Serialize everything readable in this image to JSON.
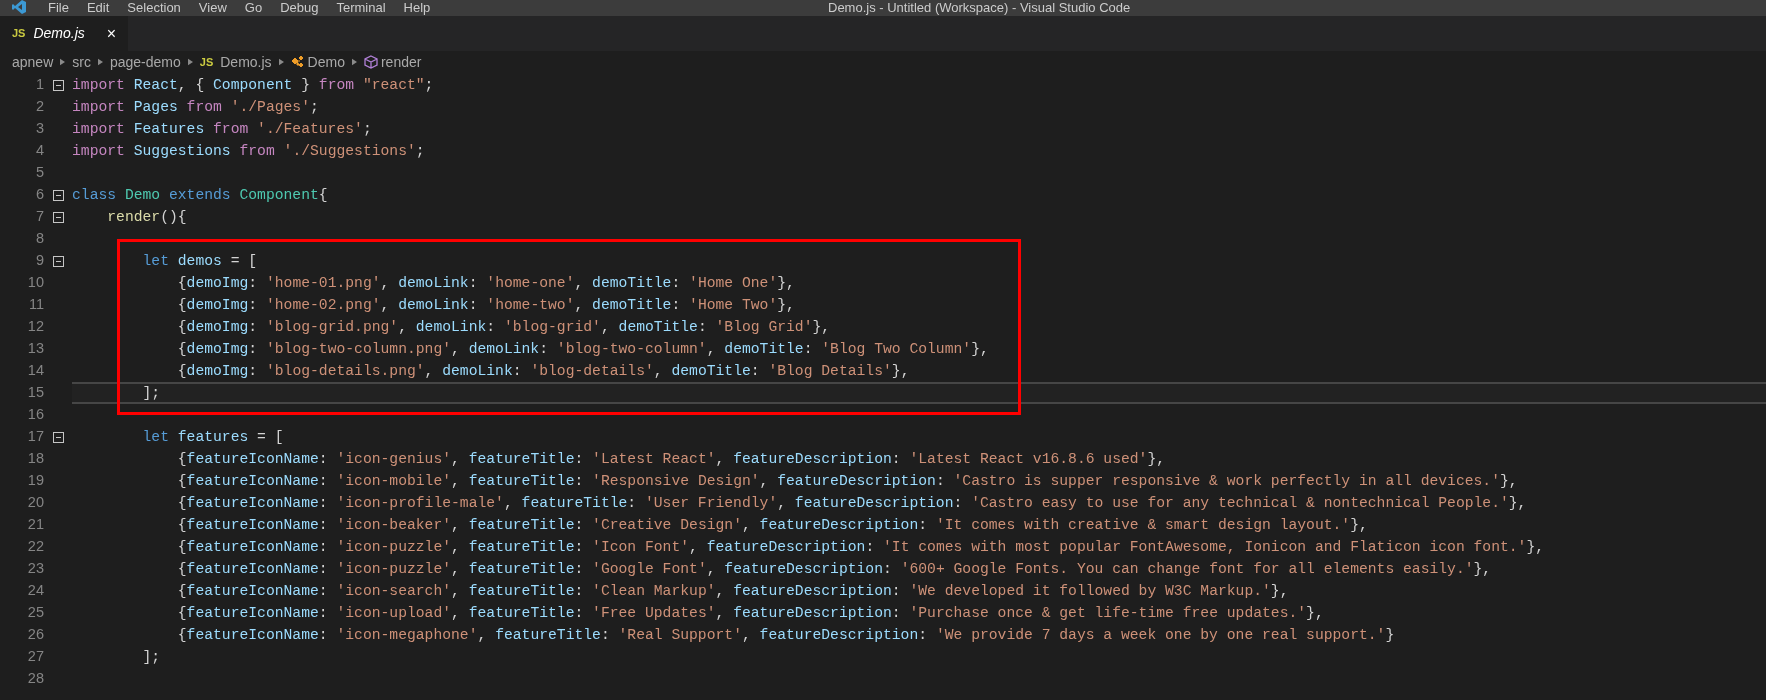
{
  "menu_bar": {
    "items": [
      "File",
      "Edit",
      "Selection",
      "View",
      "Go",
      "Debug",
      "Terminal",
      "Help"
    ],
    "title": "Demo.js - Untitled (Workspace) - Visual Studio Code"
  },
  "tabs": [
    {
      "badge": "JS",
      "label": "Demo.js",
      "close": "×",
      "selected": true
    }
  ],
  "breadcrumb": [
    {
      "kind": "folder",
      "text": "apnew"
    },
    {
      "kind": "folder",
      "text": "src"
    },
    {
      "kind": "folder",
      "text": "page-demo"
    },
    {
      "kind": "file",
      "badge": "JS",
      "text": "Demo.js"
    },
    {
      "kind": "class",
      "text": "Demo"
    },
    {
      "kind": "method",
      "text": "render"
    }
  ],
  "editor": {
    "lines": [
      {
        "number": "1",
        "foldable": true,
        "current": false,
        "tokens": [
          {
            "kind": "keyword",
            "text": "import "
          },
          {
            "kind": "variable",
            "text": "React"
          },
          {
            "kind": "punct",
            "text": ", { "
          },
          {
            "kind": "variable",
            "text": "Component"
          },
          {
            "kind": "punct",
            "text": " } "
          },
          {
            "kind": "keyword",
            "text": "from "
          },
          {
            "kind": "string",
            "text": "\"react\""
          },
          {
            "kind": "punct",
            "text": ";"
          }
        ]
      },
      {
        "number": "2",
        "foldable": false,
        "current": false,
        "tokens": [
          {
            "kind": "keyword",
            "text": "import "
          },
          {
            "kind": "variable",
            "text": "Pages"
          },
          {
            "kind": "keyword",
            "text": " from "
          },
          {
            "kind": "string",
            "text": "'./Pages'"
          },
          {
            "kind": "punct",
            "text": ";"
          }
        ]
      },
      {
        "number": "3",
        "foldable": false,
        "current": false,
        "tokens": [
          {
            "kind": "keyword",
            "text": "import "
          },
          {
            "kind": "variable",
            "text": "Features"
          },
          {
            "kind": "keyword",
            "text": " from "
          },
          {
            "kind": "string",
            "text": "'./Features'"
          },
          {
            "kind": "punct",
            "text": ";"
          }
        ]
      },
      {
        "number": "4",
        "foldable": false,
        "current": false,
        "tokens": [
          {
            "kind": "keyword",
            "text": "import "
          },
          {
            "kind": "variable",
            "text": "Suggestions"
          },
          {
            "kind": "keyword",
            "text": " from "
          },
          {
            "kind": "string",
            "text": "'./Suggestions'"
          },
          {
            "kind": "punct",
            "text": ";"
          }
        ]
      },
      {
        "number": "5",
        "foldable": false,
        "current": false
      },
      {
        "number": "6",
        "foldable": true,
        "current": false,
        "tokens": [
          {
            "kind": "storage",
            "text": "class "
          },
          {
            "kind": "type",
            "text": "Demo"
          },
          {
            "kind": "storage",
            "text": " extends "
          },
          {
            "kind": "type",
            "text": "Component"
          },
          {
            "kind": "punct",
            "text": "{"
          }
        ]
      },
      {
        "number": "7",
        "foldable": true,
        "current": false,
        "tokens": [
          {
            "kind": "function",
            "text": "    render"
          },
          {
            "kind": "punct",
            "text": "(){"
          }
        ]
      },
      {
        "number": "8",
        "foldable": false,
        "current": false
      },
      {
        "number": "9",
        "foldable": true,
        "current": false,
        "tokens": [
          {
            "kind": "storage",
            "text": "        let "
          },
          {
            "kind": "variable",
            "text": "demos"
          },
          {
            "kind": "punct",
            "text": " = ["
          }
        ]
      },
      {
        "number": "10",
        "foldable": false,
        "current": false,
        "tokens": [
          {
            "kind": "punct",
            "text": "            {"
          },
          {
            "kind": "variable",
            "text": "demoImg"
          },
          {
            "kind": "punct",
            "text": ": "
          },
          {
            "kind": "string",
            "text": "'home-01.png'"
          },
          {
            "kind": "punct",
            "text": ", "
          },
          {
            "kind": "variable",
            "text": "demoLink"
          },
          {
            "kind": "punct",
            "text": ": "
          },
          {
            "kind": "string",
            "text": "'home-one'"
          },
          {
            "kind": "punct",
            "text": ", "
          },
          {
            "kind": "variable",
            "text": "demoTitle"
          },
          {
            "kind": "punct",
            "text": ": "
          },
          {
            "kind": "string",
            "text": "'Home One'"
          },
          {
            "kind": "punct",
            "text": "},"
          }
        ]
      },
      {
        "number": "11",
        "foldable": false,
        "current": false,
        "tokens": [
          {
            "kind": "punct",
            "text": "            {"
          },
          {
            "kind": "variable",
            "text": "demoImg"
          },
          {
            "kind": "punct",
            "text": ": "
          },
          {
            "kind": "string",
            "text": "'home-02.png'"
          },
          {
            "kind": "punct",
            "text": ", "
          },
          {
            "kind": "variable",
            "text": "demoLink"
          },
          {
            "kind": "punct",
            "text": ": "
          },
          {
            "kind": "string",
            "text": "'home-two'"
          },
          {
            "kind": "punct",
            "text": ", "
          },
          {
            "kind": "variable",
            "text": "demoTitle"
          },
          {
            "kind": "punct",
            "text": ": "
          },
          {
            "kind": "string",
            "text": "'Home Two'"
          },
          {
            "kind": "punct",
            "text": "},"
          }
        ]
      },
      {
        "number": "12",
        "foldable": false,
        "current": false,
        "tokens": [
          {
            "kind": "punct",
            "text": "            {"
          },
          {
            "kind": "variable",
            "text": "demoImg"
          },
          {
            "kind": "punct",
            "text": ": "
          },
          {
            "kind": "string",
            "text": "'blog-grid.png'"
          },
          {
            "kind": "punct",
            "text": ", "
          },
          {
            "kind": "variable",
            "text": "demoLink"
          },
          {
            "kind": "punct",
            "text": ": "
          },
          {
            "kind": "string",
            "text": "'blog-grid'"
          },
          {
            "kind": "punct",
            "text": ", "
          },
          {
            "kind": "variable",
            "text": "demoTitle"
          },
          {
            "kind": "punct",
            "text": ": "
          },
          {
            "kind": "string",
            "text": "'Blog Grid'"
          },
          {
            "kind": "punct",
            "text": "},"
          }
        ]
      },
      {
        "number": "13",
        "foldable": false,
        "current": false,
        "tokens": [
          {
            "kind": "punct",
            "text": "            {"
          },
          {
            "kind": "variable",
            "text": "demoImg"
          },
          {
            "kind": "punct",
            "text": ": "
          },
          {
            "kind": "string",
            "text": "'blog-two-column.png'"
          },
          {
            "kind": "punct",
            "text": ", "
          },
          {
            "kind": "variable",
            "text": "demoLink"
          },
          {
            "kind": "punct",
            "text": ": "
          },
          {
            "kind": "string",
            "text": "'blog-two-column'"
          },
          {
            "kind": "punct",
            "text": ", "
          },
          {
            "kind": "variable",
            "text": "demoTitle"
          },
          {
            "kind": "punct",
            "text": ": "
          },
          {
            "kind": "string",
            "text": "'Blog Two Column'"
          },
          {
            "kind": "punct",
            "text": "},"
          }
        ]
      },
      {
        "number": "14",
        "foldable": false,
        "current": false,
        "tokens": [
          {
            "kind": "punct",
            "text": "            {"
          },
          {
            "kind": "variable",
            "text": "demoImg"
          },
          {
            "kind": "punct",
            "text": ": "
          },
          {
            "kind": "string",
            "text": "'blog-details.png'"
          },
          {
            "kind": "punct",
            "text": ", "
          },
          {
            "kind": "variable",
            "text": "demoLink"
          },
          {
            "kind": "punct",
            "text": ": "
          },
          {
            "kind": "string",
            "text": "'blog-details'"
          },
          {
            "kind": "punct",
            "text": ", "
          },
          {
            "kind": "variable",
            "text": "demoTitle"
          },
          {
            "kind": "punct",
            "text": ": "
          },
          {
            "kind": "string",
            "text": "'Blog Details'"
          },
          {
            "kind": "punct",
            "text": "},"
          }
        ]
      },
      {
        "number": "15",
        "foldable": false,
        "current": true,
        "tokens": [
          {
            "kind": "punct",
            "text": "        ];"
          }
        ]
      },
      {
        "number": "16",
        "foldable": false,
        "current": false
      },
      {
        "number": "17",
        "foldable": true,
        "current": false,
        "tokens": [
          {
            "kind": "storage",
            "text": "        let "
          },
          {
            "kind": "variable",
            "text": "features"
          },
          {
            "kind": "punct",
            "text": " = ["
          }
        ]
      },
      {
        "number": "18",
        "foldable": false,
        "current": false,
        "tokens": [
          {
            "kind": "punct",
            "text": "            {"
          },
          {
            "kind": "variable",
            "text": "featureIconName"
          },
          {
            "kind": "punct",
            "text": ": "
          },
          {
            "kind": "string",
            "text": "'icon-genius'"
          },
          {
            "kind": "punct",
            "text": ", "
          },
          {
            "kind": "variable",
            "text": "featureTitle"
          },
          {
            "kind": "punct",
            "text": ": "
          },
          {
            "kind": "string",
            "text": "'Latest React'"
          },
          {
            "kind": "punct",
            "text": ", "
          },
          {
            "kind": "variable",
            "text": "featureDescription"
          },
          {
            "kind": "punct",
            "text": ": "
          },
          {
            "kind": "string",
            "text": "'Latest React v16.8.6 used'"
          },
          {
            "kind": "punct",
            "text": "},"
          }
        ]
      },
      {
        "number": "19",
        "foldable": false,
        "current": false,
        "tokens": [
          {
            "kind": "punct",
            "text": "            {"
          },
          {
            "kind": "variable",
            "text": "featureIconName"
          },
          {
            "kind": "punct",
            "text": ": "
          },
          {
            "kind": "string",
            "text": "'icon-mobile'"
          },
          {
            "kind": "punct",
            "text": ", "
          },
          {
            "kind": "variable",
            "text": "featureTitle"
          },
          {
            "kind": "punct",
            "text": ": "
          },
          {
            "kind": "string",
            "text": "'Responsive Design'"
          },
          {
            "kind": "punct",
            "text": ", "
          },
          {
            "kind": "variable",
            "text": "featureDescription"
          },
          {
            "kind": "punct",
            "text": ": "
          },
          {
            "kind": "string",
            "text": "'Castro is supper responsive & work perfectly in all devices.'"
          },
          {
            "kind": "punct",
            "text": "},"
          }
        ]
      },
      {
        "number": "20",
        "foldable": false,
        "current": false,
        "tokens": [
          {
            "kind": "punct",
            "text": "            {"
          },
          {
            "kind": "variable",
            "text": "featureIconName"
          },
          {
            "kind": "punct",
            "text": ": "
          },
          {
            "kind": "string",
            "text": "'icon-profile-male'"
          },
          {
            "kind": "punct",
            "text": ", "
          },
          {
            "kind": "variable",
            "text": "featureTitle"
          },
          {
            "kind": "punct",
            "text": ": "
          },
          {
            "kind": "string",
            "text": "'User Friendly'"
          },
          {
            "kind": "punct",
            "text": ", "
          },
          {
            "kind": "variable",
            "text": "featureDescription"
          },
          {
            "kind": "punct",
            "text": ": "
          },
          {
            "kind": "string",
            "text": "'Castro easy to use for any technical & nontechnical People.'"
          },
          {
            "kind": "punct",
            "text": "},"
          }
        ]
      },
      {
        "number": "21",
        "foldable": false,
        "current": false,
        "tokens": [
          {
            "kind": "punct",
            "text": "            {"
          },
          {
            "kind": "variable",
            "text": "featureIconName"
          },
          {
            "kind": "punct",
            "text": ": "
          },
          {
            "kind": "string",
            "text": "'icon-beaker'"
          },
          {
            "kind": "punct",
            "text": ", "
          },
          {
            "kind": "variable",
            "text": "featureTitle"
          },
          {
            "kind": "punct",
            "text": ": "
          },
          {
            "kind": "string",
            "text": "'Creative Design'"
          },
          {
            "kind": "punct",
            "text": ", "
          },
          {
            "kind": "variable",
            "text": "featureDescription"
          },
          {
            "kind": "punct",
            "text": ": "
          },
          {
            "kind": "string",
            "text": "'It comes with creative & smart design layout.'"
          },
          {
            "kind": "punct",
            "text": "},"
          }
        ]
      },
      {
        "number": "22",
        "foldable": false,
        "current": false,
        "tokens": [
          {
            "kind": "punct",
            "text": "            {"
          },
          {
            "kind": "variable",
            "text": "featureIconName"
          },
          {
            "kind": "punct",
            "text": ": "
          },
          {
            "kind": "string",
            "text": "'icon-puzzle'"
          },
          {
            "kind": "punct",
            "text": ", "
          },
          {
            "kind": "variable",
            "text": "featureTitle"
          },
          {
            "kind": "punct",
            "text": ": "
          },
          {
            "kind": "string",
            "text": "'Icon Font'"
          },
          {
            "kind": "punct",
            "text": ", "
          },
          {
            "kind": "variable",
            "text": "featureDescription"
          },
          {
            "kind": "punct",
            "text": ": "
          },
          {
            "kind": "string",
            "text": "'It comes with most popular FontAwesome, Ionicon and Flaticon icon font.'"
          },
          {
            "kind": "punct",
            "text": "},"
          }
        ]
      },
      {
        "number": "23",
        "foldable": false,
        "current": false,
        "tokens": [
          {
            "kind": "punct",
            "text": "            {"
          },
          {
            "kind": "variable",
            "text": "featureIconName"
          },
          {
            "kind": "punct",
            "text": ": "
          },
          {
            "kind": "string",
            "text": "'icon-puzzle'"
          },
          {
            "kind": "punct",
            "text": ", "
          },
          {
            "kind": "variable",
            "text": "featureTitle"
          },
          {
            "kind": "punct",
            "text": ": "
          },
          {
            "kind": "string",
            "text": "'Google Font'"
          },
          {
            "kind": "punct",
            "text": ", "
          },
          {
            "kind": "variable",
            "text": "featureDescription"
          },
          {
            "kind": "punct",
            "text": ": "
          },
          {
            "kind": "string",
            "text": "'600+ Google Fonts. You can change font for all elements easily.'"
          },
          {
            "kind": "punct",
            "text": "},"
          }
        ]
      },
      {
        "number": "24",
        "foldable": false,
        "current": false,
        "tokens": [
          {
            "kind": "punct",
            "text": "            {"
          },
          {
            "kind": "variable",
            "text": "featureIconName"
          },
          {
            "kind": "punct",
            "text": ": "
          },
          {
            "kind": "string",
            "text": "'icon-search'"
          },
          {
            "kind": "punct",
            "text": ", "
          },
          {
            "kind": "variable",
            "text": "featureTitle"
          },
          {
            "kind": "punct",
            "text": ": "
          },
          {
            "kind": "string",
            "text": "'Clean Markup'"
          },
          {
            "kind": "punct",
            "text": ", "
          },
          {
            "kind": "variable",
            "text": "featureDescription"
          },
          {
            "kind": "punct",
            "text": ": "
          },
          {
            "kind": "string",
            "text": "'We developed it followed by W3C Markup.'"
          },
          {
            "kind": "punct",
            "text": "},"
          }
        ]
      },
      {
        "number": "25",
        "foldable": false,
        "current": false,
        "tokens": [
          {
            "kind": "punct",
            "text": "            {"
          },
          {
            "kind": "variable",
            "text": "featureIconName"
          },
          {
            "kind": "punct",
            "text": ": "
          },
          {
            "kind": "string",
            "text": "'icon-upload'"
          },
          {
            "kind": "punct",
            "text": ", "
          },
          {
            "kind": "variable",
            "text": "featureTitle"
          },
          {
            "kind": "punct",
            "text": ": "
          },
          {
            "kind": "string",
            "text": "'Free Updates'"
          },
          {
            "kind": "punct",
            "text": ", "
          },
          {
            "kind": "variable",
            "text": "featureDescription"
          },
          {
            "kind": "punct",
            "text": ": "
          },
          {
            "kind": "string",
            "text": "'Purchase once & get life-time free updates.'"
          },
          {
            "kind": "punct",
            "text": "},"
          }
        ]
      },
      {
        "number": "26",
        "foldable": false,
        "current": false,
        "tokens": [
          {
            "kind": "punct",
            "text": "            {"
          },
          {
            "kind": "variable",
            "text": "featureIconName"
          },
          {
            "kind": "punct",
            "text": ": "
          },
          {
            "kind": "string",
            "text": "'icon-megaphone'"
          },
          {
            "kind": "punct",
            "text": ", "
          },
          {
            "kind": "variable",
            "text": "featureTitle"
          },
          {
            "kind": "punct",
            "text": ": "
          },
          {
            "kind": "string",
            "text": "'Real Support'"
          },
          {
            "kind": "punct",
            "text": ", "
          },
          {
            "kind": "variable",
            "text": "featureDescription"
          },
          {
            "kind": "punct",
            "text": ": "
          },
          {
            "kind": "string",
            "text": "'We provide 7 days a week one by one real support.'"
          },
          {
            "kind": "punct",
            "text": "}"
          }
        ]
      },
      {
        "number": "27",
        "foldable": false,
        "current": false,
        "tokens": [
          {
            "kind": "punct",
            "text": "        ];"
          }
        ]
      },
      {
        "number": "28",
        "foldable": false,
        "current": false
      }
    ]
  }
}
